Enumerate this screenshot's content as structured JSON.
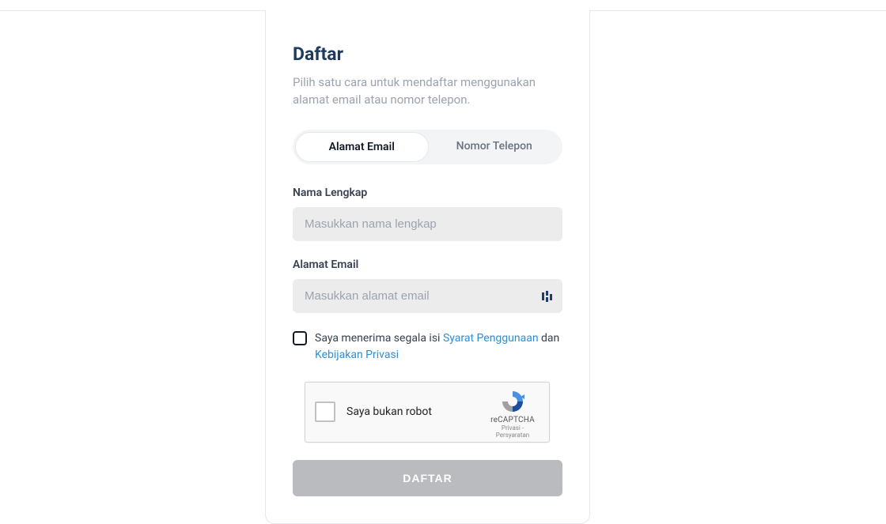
{
  "title": "Daftar",
  "subtitle": "Pilih satu cara untuk mendaftar menggunakan alamat email atau nomor telepon.",
  "tabs": {
    "email": "Alamat Email",
    "phone": "Nomor Telepon"
  },
  "fields": {
    "name": {
      "label": "Nama Lengkap",
      "placeholder": "Masukkan nama lengkap"
    },
    "email": {
      "label": "Alamat Email",
      "placeholder": "Masukkan alamat email"
    }
  },
  "consent": {
    "prefix": "Saya menerima segala isi ",
    "terms_link": "Syarat Penggunaan",
    "middle": " dan ",
    "privacy_link": "Kebijakan Privasi"
  },
  "recaptcha": {
    "label": "Saya bukan robot",
    "brand": "reCAPTCHA",
    "terms": "Privasi - Persyaratan"
  },
  "submit_label": "DAFTAR"
}
